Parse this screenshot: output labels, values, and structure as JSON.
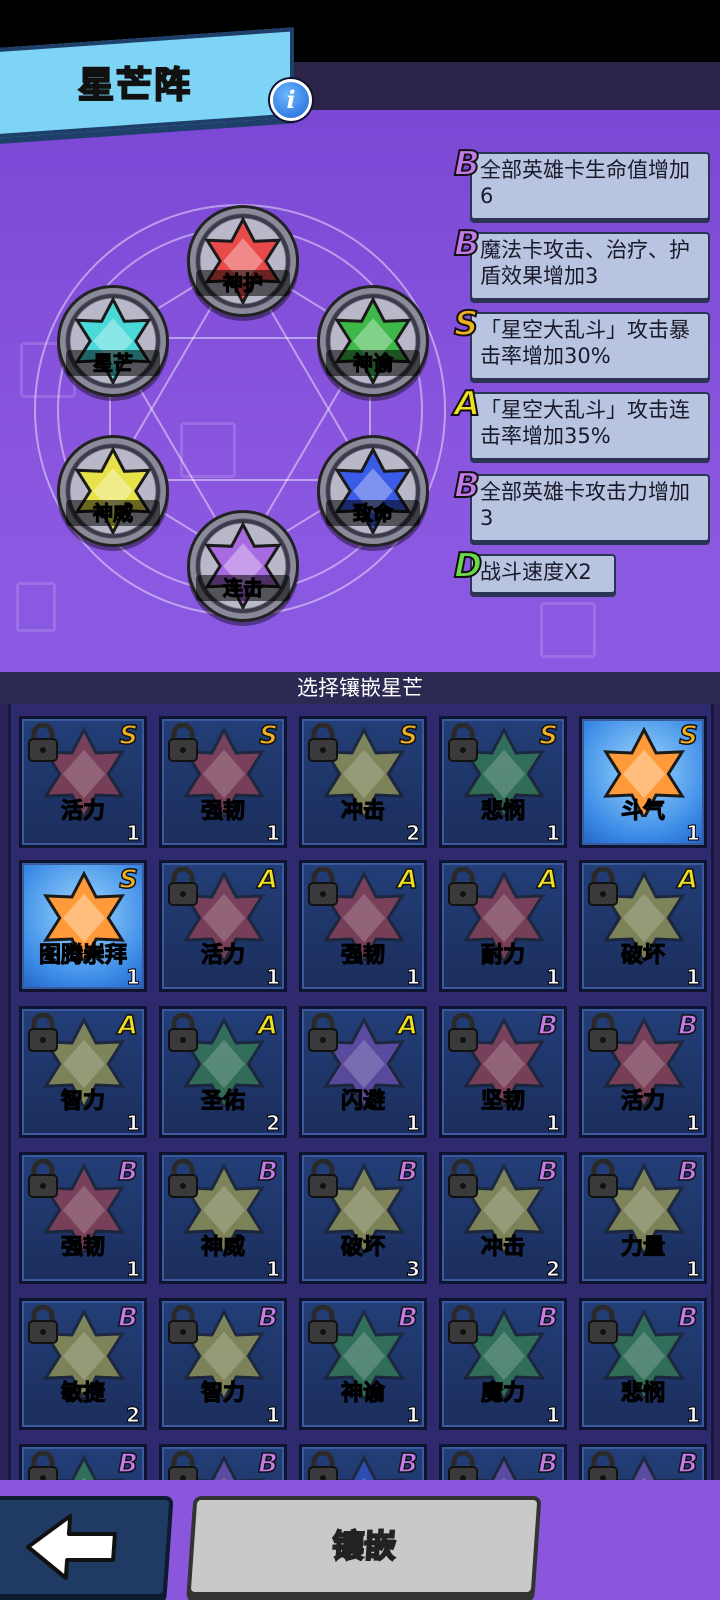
{
  "title": "星芒阵",
  "info_icon": "i",
  "formation": [
    {
      "id": "shenhu",
      "label": "神护",
      "color": "#e84a4a"
    },
    {
      "id": "xingmang",
      "label": "星芒",
      "color": "#4ad9d9"
    },
    {
      "id": "shenyu",
      "label": "神谕",
      "color": "#3fb84a"
    },
    {
      "id": "shenwei",
      "label": "神威",
      "color": "#e8e24a"
    },
    {
      "id": "zhiming",
      "label": "致命",
      "color": "#3a5ae8"
    },
    {
      "id": "lianji",
      "label": "连击",
      "color": "#a86ae0"
    }
  ],
  "bonuses": [
    {
      "grade": "B",
      "grade_color": "#c47ae8",
      "text": "全部英雄卡生命值增加6"
    },
    {
      "grade": "B",
      "grade_color": "#c47ae8",
      "text": "魔法卡攻击、治疗、护盾效果增加3"
    },
    {
      "grade": "S",
      "grade_color": "#f0b020",
      "text": "「星空大乱斗」攻击暴击率增加30%"
    },
    {
      "grade": "A",
      "grade_color": "#f0e020",
      "text": "「星空大乱斗」攻击连击率增加35%"
    },
    {
      "grade": "B",
      "grade_color": "#c47ae8",
      "text": "全部英雄卡攻击力增加3"
    },
    {
      "grade": "D",
      "grade_color": "#6ad84a",
      "text": "战斗速度X2"
    }
  ],
  "section_title": "选择镶嵌星芒",
  "cards": [
    {
      "name": "活力",
      "grade": "S",
      "count": "1",
      "color": "#c0474a",
      "locked": true
    },
    {
      "name": "强韧",
      "grade": "S",
      "count": "1",
      "color": "#c0474a",
      "locked": true
    },
    {
      "name": "冲击",
      "grade": "S",
      "count": "2",
      "color": "#c9c24a",
      "locked": true
    },
    {
      "name": "悲悯",
      "grade": "S",
      "count": "1",
      "color": "#3f9a4a",
      "locked": true
    },
    {
      "name": "斗气",
      "grade": "S",
      "count": "1",
      "color": "#ff9a3a",
      "locked": false
    },
    {
      "name": "图腾崇拜",
      "grade": "S",
      "count": "1",
      "color": "#ff9a3a",
      "locked": false
    },
    {
      "name": "活力",
      "grade": "A",
      "count": "1",
      "color": "#c0474a",
      "locked": true
    },
    {
      "name": "强韧",
      "grade": "A",
      "count": "1",
      "color": "#c0474a",
      "locked": true
    },
    {
      "name": "耐力",
      "grade": "A",
      "count": "1",
      "color": "#c0474a",
      "locked": true
    },
    {
      "name": "破坏",
      "grade": "A",
      "count": "1",
      "color": "#c9c24a",
      "locked": true
    },
    {
      "name": "智力",
      "grade": "A",
      "count": "1",
      "color": "#c9c24a",
      "locked": true
    },
    {
      "name": "圣佑",
      "grade": "A",
      "count": "2",
      "color": "#3f9a4a",
      "locked": true
    },
    {
      "name": "闪避",
      "grade": "A",
      "count": "1",
      "color": "#8a5ac8",
      "locked": true
    },
    {
      "name": "坚韧",
      "grade": "B",
      "count": "1",
      "color": "#c0474a",
      "locked": true
    },
    {
      "name": "活力",
      "grade": "B",
      "count": "1",
      "color": "#c0474a",
      "locked": true
    },
    {
      "name": "强韧",
      "grade": "B",
      "count": "1",
      "color": "#c0474a",
      "locked": true
    },
    {
      "name": "神威",
      "grade": "B",
      "count": "1",
      "color": "#c9c24a",
      "locked": true
    },
    {
      "name": "破坏",
      "grade": "B",
      "count": "3",
      "color": "#c9c24a",
      "locked": true
    },
    {
      "name": "冲击",
      "grade": "B",
      "count": "2",
      "color": "#c9c24a",
      "locked": true
    },
    {
      "name": "力量",
      "grade": "B",
      "count": "1",
      "color": "#c9c24a",
      "locked": true
    },
    {
      "name": "敏捷",
      "grade": "B",
      "count": "2",
      "color": "#c9c24a",
      "locked": true
    },
    {
      "name": "智力",
      "grade": "B",
      "count": "1",
      "color": "#c9c24a",
      "locked": true
    },
    {
      "name": "神谕",
      "grade": "B",
      "count": "1",
      "color": "#3f9a4a",
      "locked": true
    },
    {
      "name": "魔力",
      "grade": "B",
      "count": "1",
      "color": "#3f9a4a",
      "locked": true
    },
    {
      "name": "悲悯",
      "grade": "B",
      "count": "1",
      "color": "#3f9a4a",
      "locked": true
    },
    {
      "name": "",
      "grade": "B",
      "count": "",
      "color": "#3f9a4a",
      "locked": true
    },
    {
      "name": "",
      "grade": "B",
      "count": "",
      "color": "#8a5ac8",
      "locked": true
    },
    {
      "name": "",
      "grade": "B",
      "count": "",
      "color": "#3a5ae8",
      "locked": true
    },
    {
      "name": "",
      "grade": "B",
      "count": "",
      "color": "#8a5ac8",
      "locked": true
    },
    {
      "name": "",
      "grade": "B",
      "count": "",
      "color": "#8a5ac8",
      "locked": true
    }
  ],
  "grade_colors": {
    "S": "#f0b020",
    "A": "#f0e020",
    "B": "#c47ae8"
  },
  "buttons": {
    "back_icon": "arrow-left-icon",
    "embed_label": "镶嵌"
  }
}
